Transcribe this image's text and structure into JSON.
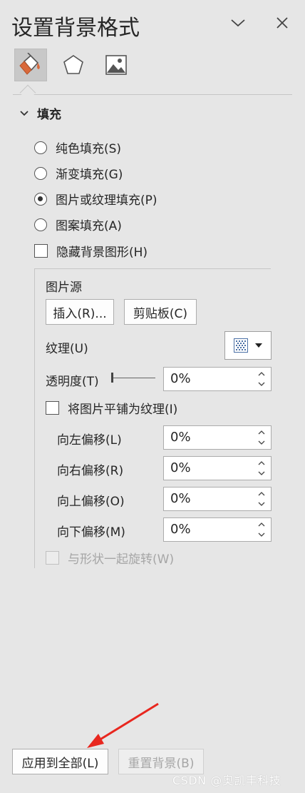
{
  "title": "设置背景格式",
  "icons": {
    "collapse": "chevron-down-icon",
    "close": "close-icon",
    "tab_fill": "paint-bucket-icon",
    "tab_effects": "pentagon-icon",
    "tab_picture": "picture-icon"
  },
  "section": {
    "label": "填充"
  },
  "fill_options": [
    {
      "label": "纯色填充(S)",
      "checked": false
    },
    {
      "label": "渐变填充(G)",
      "checked": false
    },
    {
      "label": "图片或纹理填充(P)",
      "checked": true
    },
    {
      "label": "图案填充(A)",
      "checked": false
    }
  ],
  "hide_background": {
    "label": "隐藏背景图形(H)",
    "checked": false
  },
  "picture_source": {
    "label": "图片源",
    "insert_button": "插入(R)...",
    "clipboard_button": "剪贴板(C)"
  },
  "texture": {
    "label": "纹理(U)"
  },
  "transparency": {
    "label": "透明度(T)",
    "value": "0%"
  },
  "tile": {
    "label": "将图片平铺为纹理(I)",
    "checked": false
  },
  "offsets": [
    {
      "label": "向左偏移(L)",
      "value": "0%"
    },
    {
      "label": "向右偏移(R)",
      "value": "0%"
    },
    {
      "label": "向上偏移(O)",
      "value": "0%"
    },
    {
      "label": "向下偏移(M)",
      "value": "0%"
    }
  ],
  "rotate_with_shape": {
    "label": "与形状一起旋转(W)",
    "checked": false,
    "disabled": true
  },
  "footer": {
    "apply_all_button": "应用到全部(L)",
    "reset_button": "重置背景(B)"
  },
  "watermark": "CSDN @奥凯丰科技",
  "colors": {
    "panel_bg": "#e6e6e6",
    "accent_orange": "#d9693b",
    "annotation_red": "#e8271f"
  }
}
